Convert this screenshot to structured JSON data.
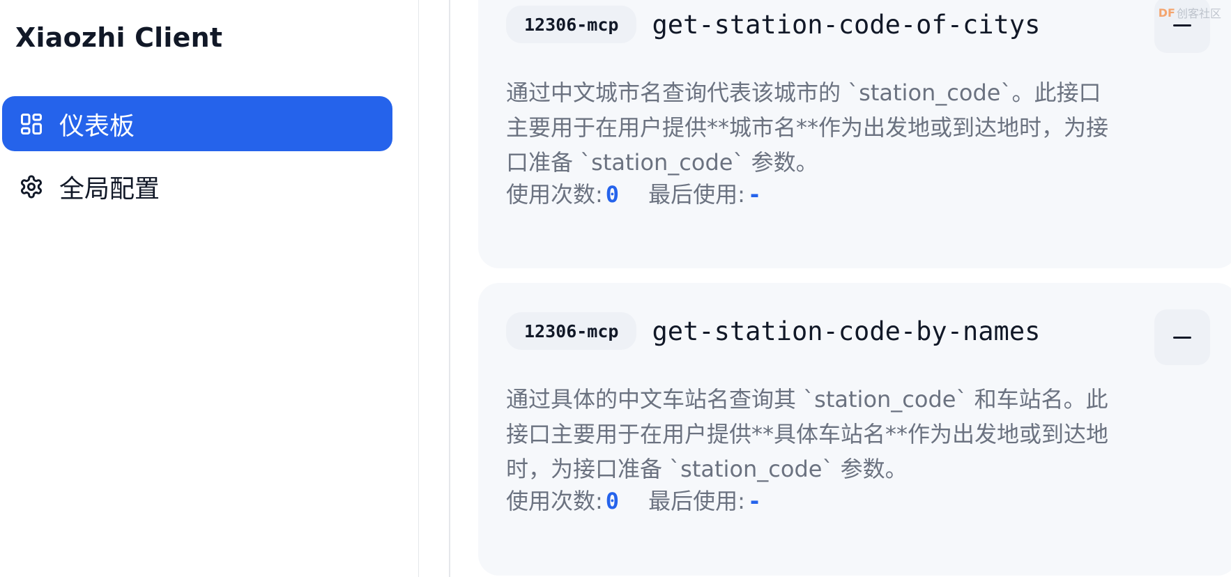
{
  "app": {
    "title": "Xiaozhi Client"
  },
  "sidebar": {
    "items": [
      {
        "label": "仪表板",
        "icon": "dashboard-grid-icon",
        "active": true
      },
      {
        "label": "全局配置",
        "icon": "gear-icon",
        "active": false
      }
    ]
  },
  "tools": [
    {
      "server": "12306-mcp",
      "name": "get-station-code-of-citys",
      "description": "通过中文城市名查询代表该城市的 `station_code`。此接口主要用于在用户提供**城市名**作为出发地或到达地时，为接口准备 `station_code` 参数。",
      "usage_label": "使用次数:",
      "usage_count": "0",
      "last_used_label": "最后使用:",
      "last_used": "-"
    },
    {
      "server": "12306-mcp",
      "name": "get-station-code-by-names",
      "description": "通过具体的中文车站名查询其 `station_code` 和车站名。此接口主要用于在用户提供**具体车站名**作为出发地或到达地时，为接口准备 `station_code` 参数。",
      "usage_label": "使用次数:",
      "usage_count": "0",
      "last_used_label": "最后使用:",
      "last_used": "-"
    }
  ],
  "watermark": {
    "brand": "DF",
    "text": "创客社区"
  },
  "colors": {
    "accent": "#2563eb",
    "card_bg": "#f6f8fb",
    "muted_text": "#6b7280"
  }
}
